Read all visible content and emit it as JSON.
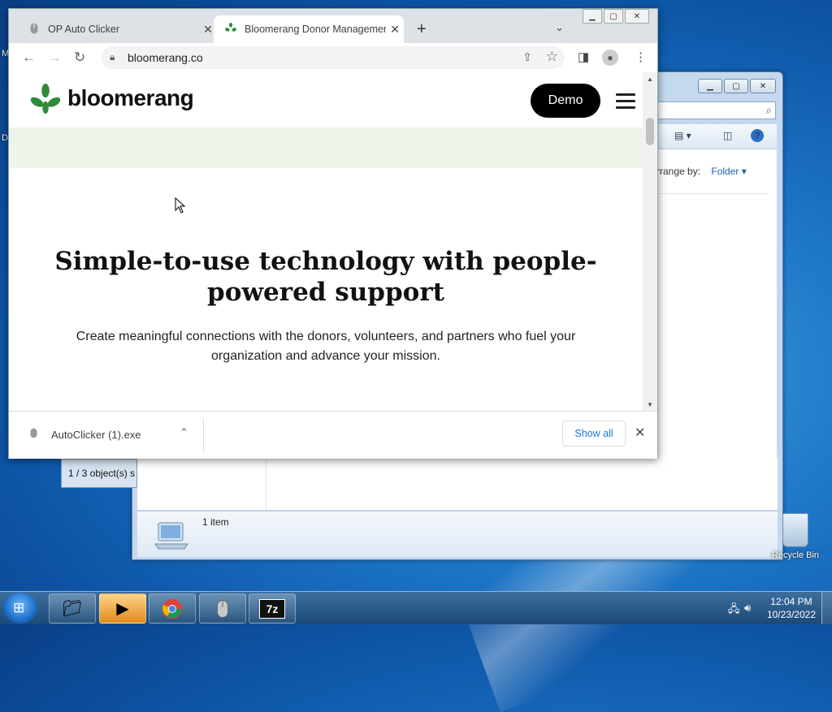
{
  "desktop": {
    "edge_labels": [
      "M",
      "D"
    ],
    "recycle_bin_label": "Recycle Bin"
  },
  "explorer": {
    "arrange_by_label": "rrange by:",
    "arrange_by_value": "Folder",
    "status_count": "1 item"
  },
  "small_window": {
    "status_text": "1 / 3 object(s) s"
  },
  "chrome": {
    "tabs": [
      {
        "title": "OP Auto Clicker",
        "favicon": "mouse-icon"
      },
      {
        "title": "Bloomerang Donor Management",
        "favicon": "bloomerang-leaf-icon"
      }
    ],
    "url": "bloomerang.co",
    "download": {
      "filename": "AutoClicker (1).exe",
      "show_all_label": "Show all"
    }
  },
  "page": {
    "brand": "bloomerang",
    "demo_label": "Demo",
    "hero_title": "Simple-to-use technology with people-powered support",
    "hero_sub": "Create meaningful connections with the donors, volunteers, and partners who fuel your organization and advance your mission."
  },
  "taskbar": {
    "time": "12:04 PM",
    "date": "10/23/2022",
    "items": [
      "explorer-icon",
      "media-player-icon",
      "chrome-icon",
      "mouse-icon",
      "7zip-icon"
    ],
    "sevenzip_label": "7z"
  },
  "colors": {
    "brand_green": "#2e8b3a",
    "link_blue": "#1a73e8",
    "promo_band": "#edf5ea"
  }
}
